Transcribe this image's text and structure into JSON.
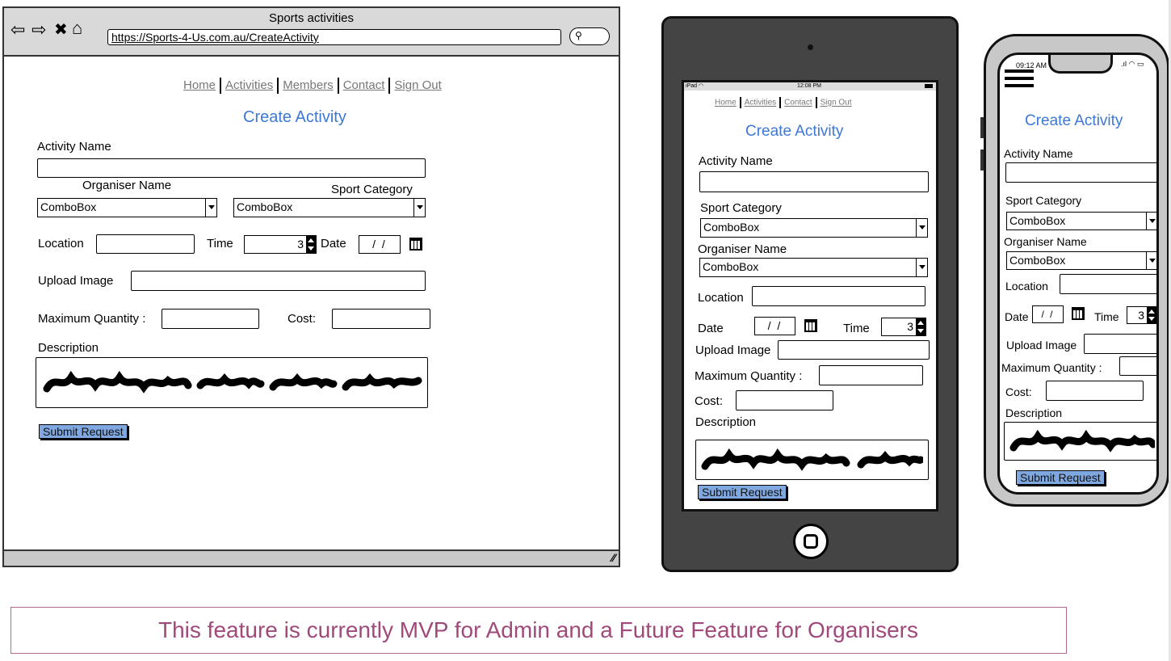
{
  "browser": {
    "title": "Sports activities",
    "url": "https://Sports-4-Us.com.au/CreateActivity"
  },
  "nav": {
    "home": "Home",
    "activities": "Activities",
    "members": "Members",
    "contact": "Contact",
    "signout": "Sign Out"
  },
  "form": {
    "heading": "Create Activity",
    "activity_name": "Activity Name",
    "organiser_name": "Organiser Name",
    "sport_category": "Sport Category",
    "combo_value": "ComboBox",
    "location": "Location",
    "time": "Time",
    "time_value": "3",
    "date": "Date",
    "date_value": "/ /",
    "upload_image": "Upload Image",
    "maximum_quantity": "Maximum Quantity :",
    "cost": "Cost:",
    "description": "Description",
    "submit": "Submit Request"
  },
  "tablet": {
    "status_left": "iPad",
    "status_time": "12:08 PM"
  },
  "phone": {
    "status_time": "09:12 AM"
  },
  "note": "This feature is currently MVP for Admin and a Future Feature for Organisers",
  "colors": {
    "accent_blue": "#3d78d6",
    "button_blue": "#7fa7e0",
    "note_text": "#a04a7c",
    "tablet_body": "#444444",
    "phone_body": "#c8c8c8"
  }
}
